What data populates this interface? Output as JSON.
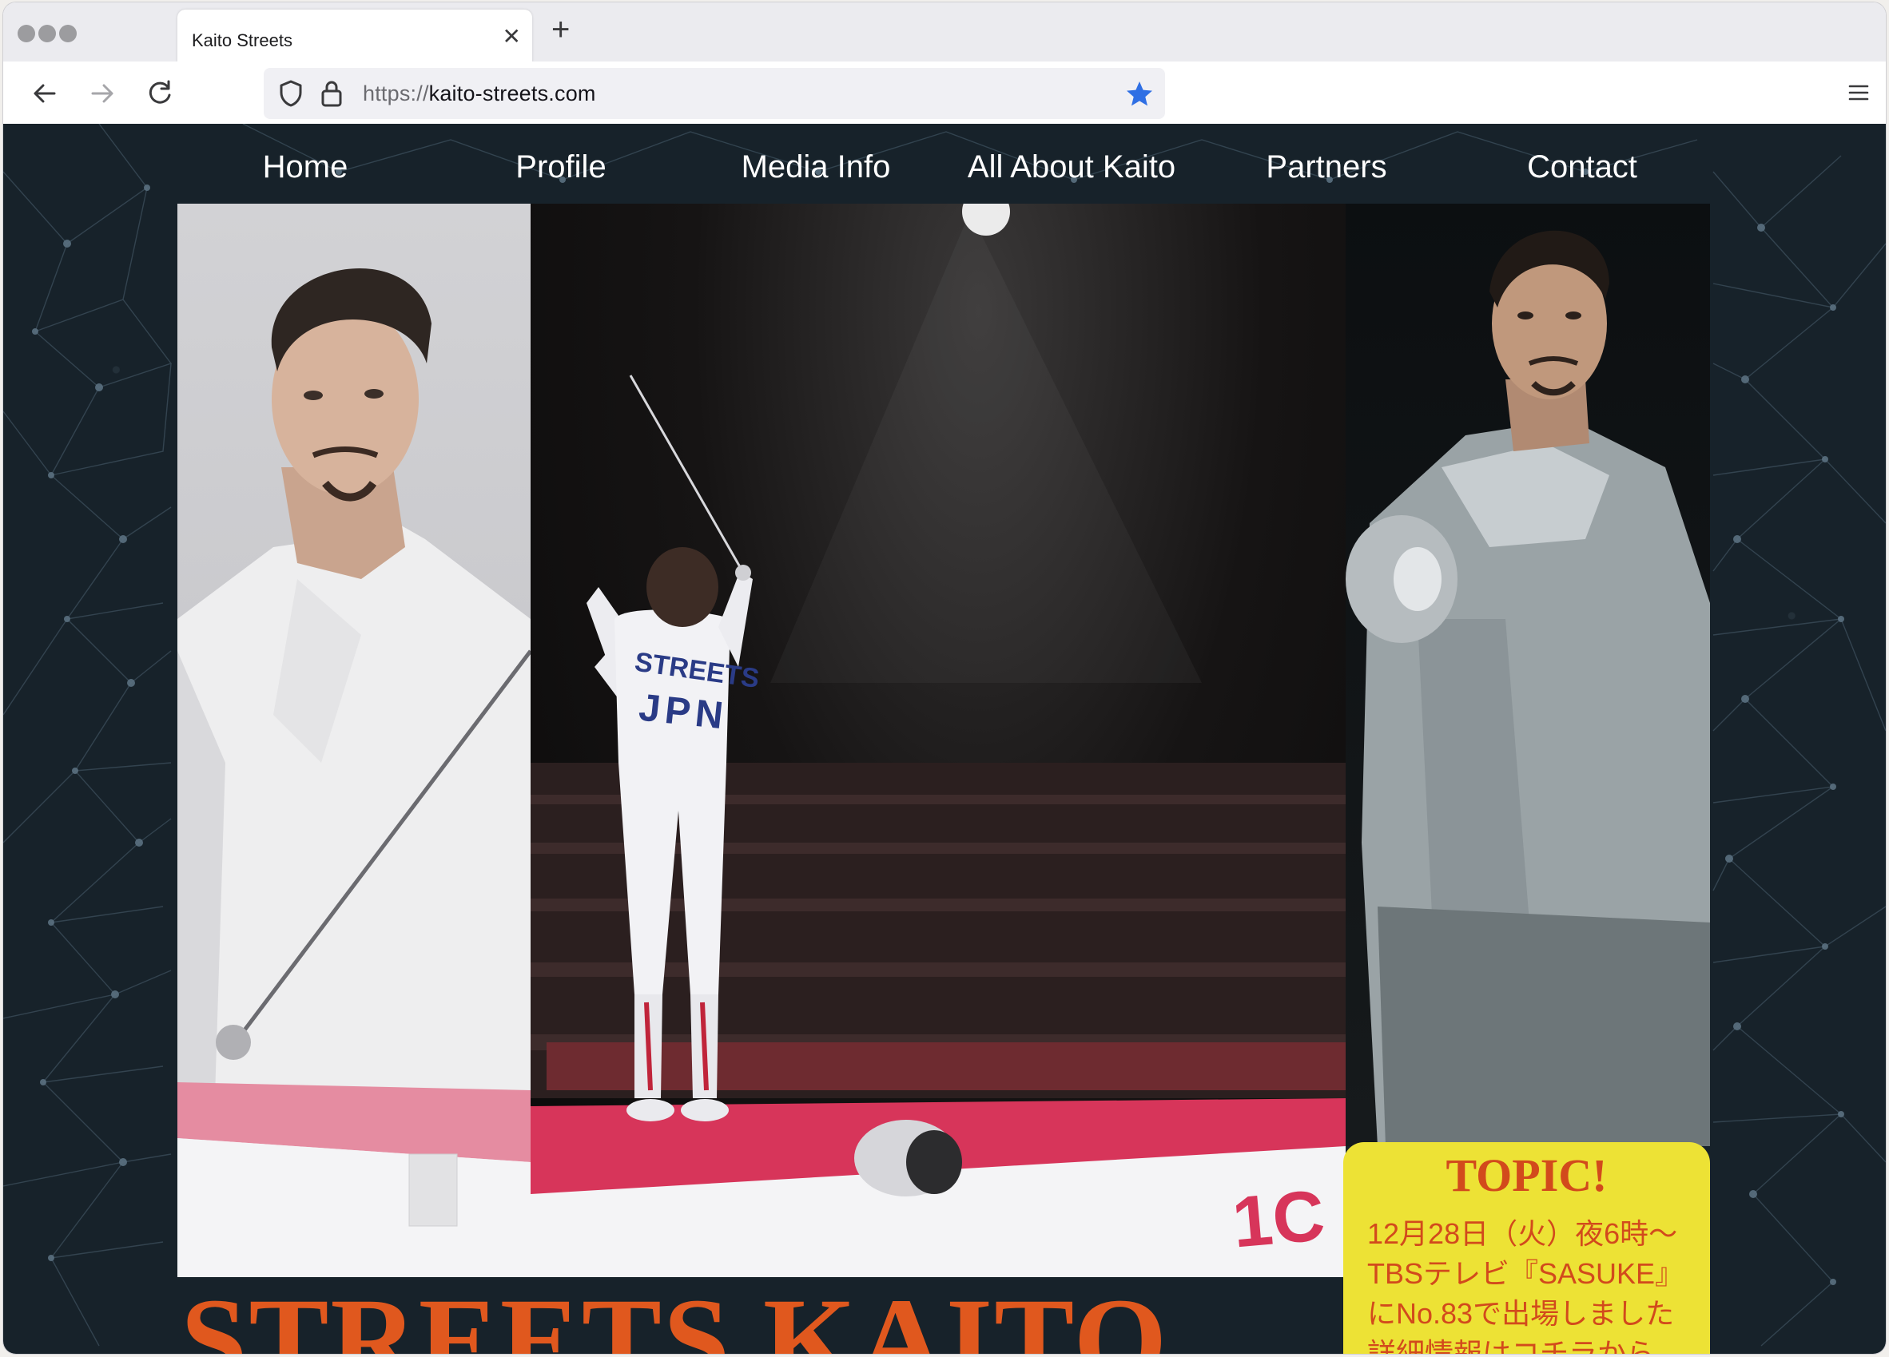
{
  "browser": {
    "tab_title": "Kaito Streets",
    "url_protocol": "https://",
    "url_host": "kaito-streets.com",
    "bookmark_star_color": "#2f6fe4",
    "icons": [
      "back-arrow-icon",
      "forward-arrow-icon",
      "reload-icon",
      "shield-icon",
      "lock-icon",
      "star-icon",
      "hamburger-menu-icon",
      "close-icon",
      "plus-icon"
    ]
  },
  "site": {
    "nav": [
      "Home",
      "Profile",
      "Media Info",
      "All About Kaito",
      "Partners",
      "Contact"
    ],
    "jersey": {
      "name": "STREETS",
      "country": "JPN"
    },
    "topic": {
      "title": "TOPIC!",
      "line1": "12月28日（火）夜6時～",
      "line2": "TBSテレビ『SASUKE』",
      "line3": "にNo.83で出場しました",
      "line4_pre": "詳細情報は",
      "line4_link": "コチラ",
      "line4_post": "から"
    },
    "hero_name": "STREETS KAITO",
    "colors": {
      "background": "#17222a",
      "accent": "#e0581e",
      "topic_bg": "#ede235"
    }
  }
}
